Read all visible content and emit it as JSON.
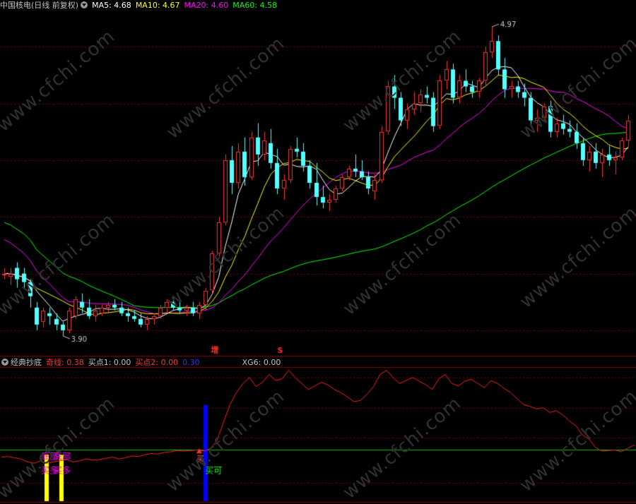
{
  "main_header": {
    "title": "中国核电(日线 前复权)",
    "ma5": "MA5: 4.68",
    "ma10": "MA10: 4.67",
    "ma20": "MA20: 4.60",
    "ma60": "MA60: 4.58"
  },
  "sub_header": {
    "title": "经典抄底",
    "qixian": "奇线: 0.38",
    "buy1": "买点1: 0.00",
    "buy2": "买点2: 0.00",
    "v4": "0.30",
    "xg6": "XG6: 0.00"
  },
  "watermark": "www.cfchi.com",
  "colors": {
    "up": "#ff3232",
    "down": "#54ffff",
    "ma5": "#ffffff",
    "ma10": "#ffff00",
    "ma20": "#ff00ff",
    "ma60": "#00ff00",
    "grid": "#6e0000",
    "oscillator": "#ff2020",
    "threshold": "#00c000",
    "bottom_bar": "#ffff00",
    "buy_bar": "#0000ff"
  },
  "chart_data": [
    {
      "type": "candlestick",
      "ylim": [
        3.82,
        5.02
      ],
      "high_label": "4.97",
      "low_label": "3.90",
      "markers": [
        "增",
        "S"
      ],
      "candles": [
        [
          4.1,
          4.12,
          4.08,
          4.1
        ],
        [
          4.09,
          4.12,
          4.06,
          4.1
        ],
        [
          4.12,
          4.14,
          4.05,
          4.08
        ],
        [
          4.1,
          4.12,
          4.05,
          4.07
        ],
        [
          4.07,
          4.08,
          3.98,
          4.02
        ],
        [
          3.98,
          4.0,
          3.9,
          3.92
        ],
        [
          3.93,
          3.98,
          3.91,
          3.97
        ],
        [
          3.96,
          3.98,
          3.92,
          3.95
        ],
        [
          3.94,
          3.96,
          3.9,
          3.92
        ],
        [
          3.92,
          3.93,
          3.88,
          3.9
        ],
        [
          3.9,
          3.98,
          3.89,
          3.97
        ],
        [
          3.95,
          4.02,
          3.94,
          4.01
        ],
        [
          4.0,
          4.03,
          3.96,
          3.98
        ],
        [
          3.98,
          4.01,
          3.94,
          3.95
        ],
        [
          3.95,
          3.99,
          3.93,
          3.97
        ],
        [
          3.96,
          3.99,
          3.95,
          3.98
        ],
        [
          3.98,
          4.0,
          3.96,
          3.99
        ],
        [
          3.99,
          4.01,
          3.97,
          3.98
        ],
        [
          3.98,
          4.0,
          3.95,
          3.96
        ],
        [
          3.96,
          3.98,
          3.93,
          3.95
        ],
        [
          3.95,
          3.97,
          3.93,
          3.94
        ],
        [
          3.94,
          3.96,
          3.91,
          3.92
        ],
        [
          3.92,
          3.95,
          3.9,
          3.94
        ],
        [
          3.94,
          3.96,
          3.92,
          3.95
        ],
        [
          3.95,
          3.99,
          3.94,
          3.98
        ],
        [
          3.98,
          4.01,
          3.96,
          4.0
        ],
        [
          4.0,
          4.02,
          3.97,
          3.98
        ],
        [
          3.98,
          4.0,
          3.96,
          3.97
        ],
        [
          3.97,
          3.99,
          3.95,
          3.98
        ],
        [
          3.98,
          4.0,
          3.95,
          3.96
        ],
        [
          3.96,
          4.0,
          3.94,
          3.99
        ],
        [
          3.99,
          4.05,
          3.97,
          4.04
        ],
        [
          4.04,
          4.18,
          4.03,
          4.17
        ],
        [
          4.17,
          4.3,
          4.16,
          4.28
        ],
        [
          4.28,
          4.52,
          4.27,
          4.5
        ],
        [
          4.5,
          4.55,
          4.38,
          4.42
        ],
        [
          4.42,
          4.56,
          4.4,
          4.53
        ],
        [
          4.53,
          4.58,
          4.41,
          4.44
        ],
        [
          4.44,
          4.6,
          4.43,
          4.58
        ],
        [
          4.58,
          4.63,
          4.48,
          4.52
        ],
        [
          4.52,
          4.6,
          4.5,
          4.57
        ],
        [
          4.56,
          4.61,
          4.47,
          4.49
        ],
        [
          4.49,
          4.54,
          4.38,
          4.4
        ],
        [
          4.4,
          4.45,
          4.36,
          4.43
        ],
        [
          4.43,
          4.55,
          4.42,
          4.54
        ],
        [
          4.54,
          4.58,
          4.51,
          4.53
        ],
        [
          4.53,
          4.56,
          4.46,
          4.48
        ],
        [
          4.48,
          4.5,
          4.4,
          4.42
        ],
        [
          4.42,
          4.49,
          4.34,
          4.37
        ],
        [
          4.37,
          4.41,
          4.33,
          4.35
        ],
        [
          4.35,
          4.38,
          4.32,
          4.36
        ],
        [
          4.36,
          4.41,
          4.35,
          4.4
        ],
        [
          4.4,
          4.45,
          4.39,
          4.44
        ],
        [
          4.44,
          4.48,
          4.43,
          4.47
        ],
        [
          4.47,
          4.52,
          4.44,
          4.46
        ],
        [
          4.46,
          4.5,
          4.43,
          4.44
        ],
        [
          4.44,
          4.46,
          4.38,
          4.4
        ],
        [
          4.39,
          4.45,
          4.36,
          4.43
        ],
        [
          4.43,
          4.62,
          4.42,
          4.6
        ],
        [
          4.6,
          4.78,
          4.59,
          4.76
        ],
        [
          4.76,
          4.8,
          4.68,
          4.72
        ],
        [
          4.72,
          4.74,
          4.62,
          4.64
        ],
        [
          4.64,
          4.7,
          4.61,
          4.68
        ],
        [
          4.68,
          4.74,
          4.66,
          4.7
        ],
        [
          4.7,
          4.75,
          4.67,
          4.73
        ],
        [
          4.73,
          4.76,
          4.7,
          4.72
        ],
        [
          4.72,
          4.74,
          4.6,
          4.62
        ],
        [
          4.62,
          4.8,
          4.61,
          4.78
        ],
        [
          4.78,
          4.85,
          4.75,
          4.82
        ],
        [
          4.82,
          4.84,
          4.7,
          4.72
        ],
        [
          4.72,
          4.8,
          4.7,
          4.78
        ],
        [
          4.78,
          4.82,
          4.74,
          4.76
        ],
        [
          4.76,
          4.78,
          4.72,
          4.74
        ],
        [
          4.74,
          4.79,
          4.72,
          4.78
        ],
        [
          4.78,
          4.9,
          4.76,
          4.88
        ],
        [
          4.88,
          4.97,
          4.86,
          4.92
        ],
        [
          4.92,
          4.94,
          4.8,
          4.82
        ],
        [
          4.82,
          4.86,
          4.72,
          4.75
        ],
        [
          4.75,
          4.78,
          4.72,
          4.76
        ],
        [
          4.76,
          4.78,
          4.72,
          4.74
        ],
        [
          4.74,
          4.77,
          4.69,
          4.72
        ],
        [
          4.72,
          4.74,
          4.62,
          4.64
        ],
        [
          4.64,
          4.68,
          4.6,
          4.65
        ],
        [
          4.65,
          4.7,
          4.64,
          4.69
        ],
        [
          4.69,
          4.71,
          4.58,
          4.6
        ],
        [
          4.6,
          4.65,
          4.58,
          4.63
        ],
        [
          4.63,
          4.66,
          4.59,
          4.61
        ],
        [
          4.61,
          4.64,
          4.58,
          4.6
        ],
        [
          4.6,
          4.63,
          4.54,
          4.56
        ],
        [
          4.56,
          4.58,
          4.48,
          4.5
        ],
        [
          4.5,
          4.55,
          4.46,
          4.53
        ],
        [
          4.53,
          4.56,
          4.47,
          4.49
        ],
        [
          4.49,
          4.54,
          4.44,
          4.52
        ],
        [
          4.52,
          4.55,
          4.48,
          4.5
        ],
        [
          4.5,
          4.53,
          4.45,
          4.51
        ],
        [
          4.51,
          4.58,
          4.5,
          4.57
        ],
        [
          4.57,
          4.66,
          4.55,
          4.64
        ]
      ]
    },
    {
      "type": "line",
      "name": "经典抄底",
      "ylim": [
        -0.55,
        1.65
      ],
      "threshold": 0.3,
      "values": [
        0.18,
        0.19,
        0.17,
        0.15,
        0.1,
        0.08,
        0.12,
        0.08,
        0.1,
        0.12,
        0.14,
        0.1,
        0.12,
        0.15,
        0.13,
        0.14,
        0.16,
        0.18,
        0.15,
        0.17,
        0.2,
        0.19,
        0.22,
        0.24,
        0.23,
        0.26,
        0.27,
        0.29,
        0.28,
        0.29,
        0.3,
        0.28,
        0.32,
        0.45,
        0.75,
        1.05,
        1.25,
        1.4,
        1.5,
        1.35,
        1.42,
        1.55,
        1.45,
        1.48,
        1.62,
        1.5,
        1.4,
        1.3,
        1.36,
        1.42,
        1.38,
        1.3,
        1.25,
        1.18,
        1.1,
        1.12,
        1.22,
        1.35,
        1.55,
        1.62,
        1.5,
        1.4,
        1.45,
        1.5,
        1.44,
        1.38,
        1.3,
        1.48,
        1.55,
        1.4,
        1.36,
        1.44,
        1.47,
        1.4,
        1.33,
        1.45,
        1.4,
        1.32,
        1.25,
        1.15,
        1.05,
        1.02,
        0.98,
        1.0,
        0.92,
        0.95,
        0.88,
        0.78,
        0.7,
        0.55,
        0.48,
        0.34,
        0.28,
        0.29,
        0.3,
        0.27,
        0.33,
        0.38
      ],
      "bottom_bars": [
        14,
        19
      ],
      "bottom_label_1": "底部",
      "bottom_label_2": "底部",
      "buy_label_1": "买多",
      "buy_label_2": "买多",
      "buy_bar": 71,
      "buy_bar_label": "买可",
      "arrow_index": 70,
      "arrow_label": "买"
    }
  ]
}
